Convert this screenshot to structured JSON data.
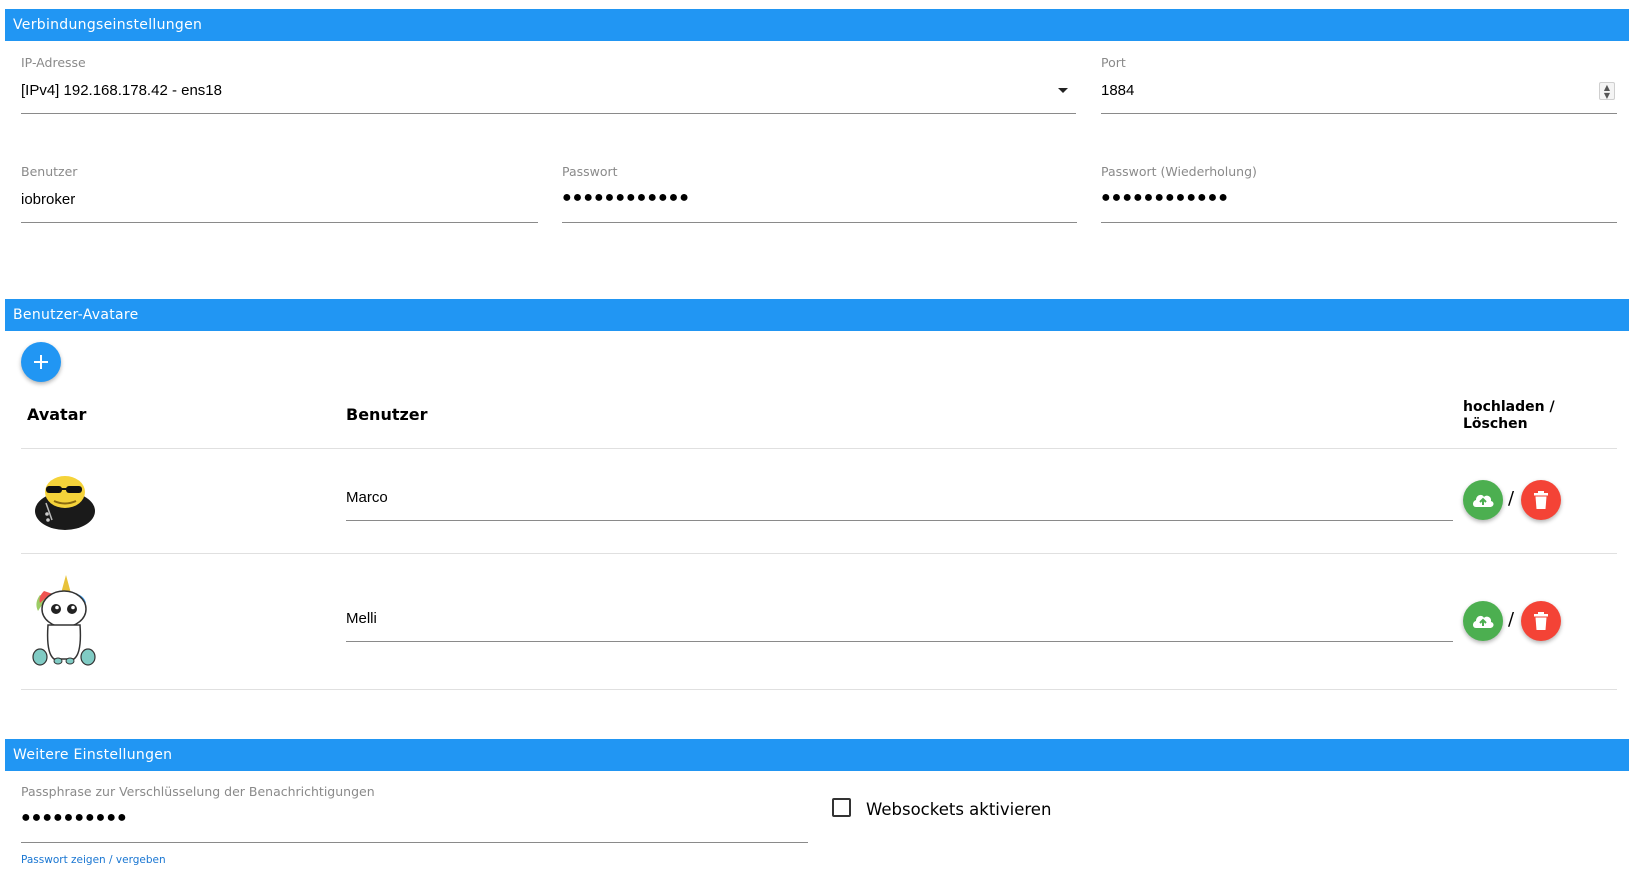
{
  "sections": {
    "connection": "Verbindungseinstellungen",
    "avatars": "Benutzer-Avatare",
    "further": "Weitere Einstellungen"
  },
  "connection": {
    "ip_label": "IP-Adresse",
    "ip_value": "[IPv4] 192.168.178.42 - ens18",
    "port_label": "Port",
    "port_value": "1884",
    "user_label": "Benutzer",
    "user_value": "iobroker",
    "password_label": "Passwort",
    "password_value": "●●●●●●●●●●●●",
    "password_repeat_label": "Passwort (Wiederholung)",
    "password_repeat_value": "●●●●●●●●●●●●"
  },
  "avatars": {
    "columns": {
      "avatar": "Avatar",
      "user": "Benutzer",
      "actions_line1": "hochladen /",
      "actions_line2": "Löschen"
    },
    "rows": [
      {
        "name": "Marco",
        "avatar_icon": "sunglasses-smiley-icon"
      },
      {
        "name": "Melli",
        "avatar_icon": "unicorn-icon"
      }
    ],
    "separator": "/"
  },
  "further": {
    "passphrase_label": "Passphrase zur Verschlüsselung der Benachrichtigungen",
    "passphrase_value": "●●●●●●●●●●",
    "show_password_link": "Passwort zeigen / vergeben",
    "websockets_label": "Websockets aktivieren",
    "websockets_checked": false
  },
  "colors": {
    "accent": "#2196f3",
    "upload": "#4caf50",
    "delete": "#f44336"
  }
}
